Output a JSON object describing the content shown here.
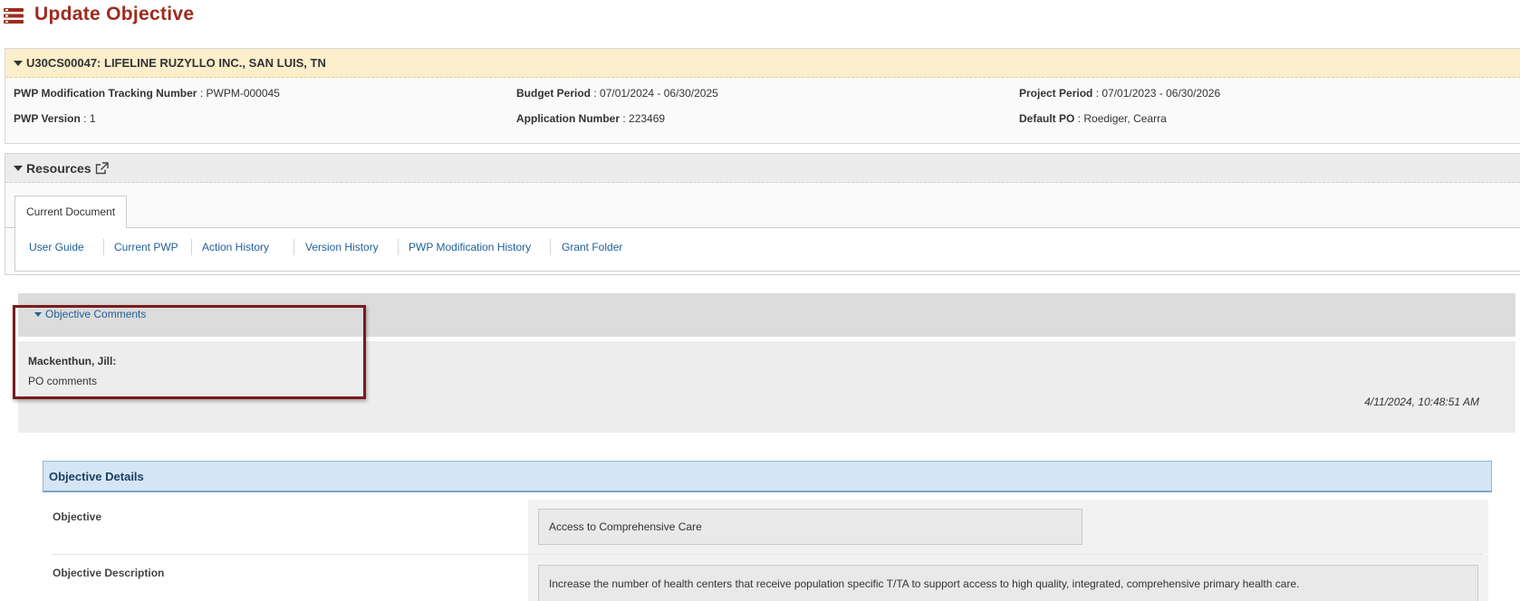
{
  "page": {
    "title": "Update Objective",
    "icon": "list-icon"
  },
  "grant": {
    "header": "U30CS00047: LIFELINE RUZYLLO INC., SAN LUIS, TN",
    "fields": {
      "tracking_label": "PWP Modification Tracking Number",
      "tracking_value": "PWPM-000045",
      "budget_label": "Budget Period",
      "budget_value": "07/01/2024 - 06/30/2025",
      "project_label": "Project Period",
      "project_value": "07/01/2023 - 06/30/2026",
      "version_label": "PWP Version",
      "version_value": "1",
      "application_label": "Application Number",
      "application_value": "223469",
      "po_label": "Default PO",
      "po_value": "Roediger, Cearra"
    },
    "separator": " : "
  },
  "resources": {
    "header": "Resources",
    "tab": "Current Document",
    "links": [
      "User Guide",
      "Current PWP",
      "Action History",
      "Version History",
      "PWP Modification History",
      "Grant Folder"
    ]
  },
  "comments": {
    "toggle": "Objective Comments",
    "author": "Mackenthun, Jill:",
    "text": "PO comments",
    "timestamp": "4/11/2024, 10:48:51 AM"
  },
  "details": {
    "title": "Objective Details",
    "objective_label": "Objective",
    "objective_value": "Access to Comprehensive Care",
    "description_label": "Objective Description",
    "description_value": "Increase the number of health centers that receive population specific T/TA to support access to high quality, integrated, comprehensive primary health care."
  },
  "colors": {
    "title": "#9b2c1e",
    "link": "#1f5f99",
    "grant_header_bg": "#fbeecb",
    "highlight": "#7a1a1a"
  }
}
